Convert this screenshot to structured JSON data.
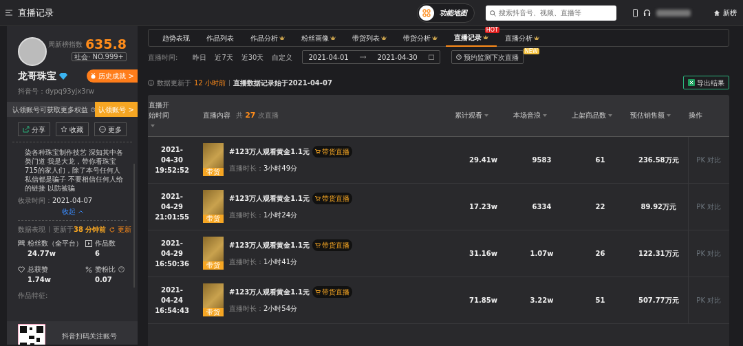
{
  "app_bar": {
    "title": "直播记录",
    "feature_map": "功能地图",
    "search": {
      "placeholder": "搜索抖音号、视频、直播等"
    },
    "new_list": "新榜"
  },
  "profile": {
    "index_label": "周新榜指数",
    "index_value": "635.8",
    "rank": "社会· NO.999+",
    "name": "龙哥珠宝",
    "history_button": "历史成就 >",
    "account_label": "抖音号：",
    "account_id": "dypq93yjx3rw",
    "claim_text": "认领账号可获取更多权益",
    "claim_button": "认领账号 >",
    "actions": [
      {
        "kind": "share",
        "label": "分享"
      },
      {
        "kind": "favorite",
        "label": "收藏"
      },
      {
        "kind": "more",
        "label": "更多"
      }
    ],
    "bio": "染各种珠宝制作技艺 深知其中各类门道 我是大龙，带你看珠宝 715的家人们，除了本号任何人私信都是骗子 不要相信任何人给的链接 以防被骗",
    "collected_label": "收录时间：",
    "collected_date": "2021-04-07",
    "collapse": "收起",
    "data_label": "数据表现",
    "updated_prefix": "更新于",
    "updated_value": "38 分钟前",
    "refresh": "更新",
    "stats": [
      {
        "kind": "fans",
        "label": "粉丝数（全平台）",
        "value": "24.77w"
      },
      {
        "kind": "works",
        "label": "作品数",
        "value": "6"
      },
      {
        "kind": "likes",
        "label": "总获赞",
        "value": "1.74w"
      },
      {
        "kind": "ratio",
        "label": "赞粉比",
        "value": "0.07",
        "help": true
      }
    ],
    "features_label": "作品特征:",
    "qr_text": "抖音扫码关注账号"
  },
  "tabs": [
    {
      "label": "趋势表现",
      "selected": false,
      "premium": false
    },
    {
      "label": "作品列表",
      "selected": false,
      "premium": false
    },
    {
      "label": "作品分析",
      "selected": false,
      "premium": true
    },
    {
      "label": "粉丝画像",
      "selected": false,
      "premium": true
    },
    {
      "label": "带货列表",
      "selected": false,
      "premium": true
    },
    {
      "label": "带货分析",
      "selected": false,
      "premium": true
    },
    {
      "label": "直播记录",
      "selected": true,
      "premium": true,
      "badge": "HOT"
    },
    {
      "label": "直播分析",
      "selected": false,
      "premium": true
    }
  ],
  "filters": {
    "label": "直播时间:",
    "options": [
      "昨日",
      "近7天",
      "近30天",
      "自定义"
    ],
    "date_start": "2021-04-01",
    "date_end": "2021-04-30",
    "monitor_button": "预约监测下次直播",
    "monitor_badge": "NEW"
  },
  "notice": {
    "prefix": "数据更新于",
    "age": "12 小时前",
    "record_start": "直播数据记录始于2021-04-07",
    "export_button": "导出结果"
  },
  "table": {
    "columns": [
      {
        "label": "直播开始时间",
        "sortable": true
      },
      {
        "label": "直播内容",
        "sortable": false,
        "count": "共 **27** 次直播"
      },
      {
        "label": "累计观看",
        "sortable": true
      },
      {
        "label": "本场音浪",
        "sortable": true
      },
      {
        "label": "上架商品数",
        "sortable": true
      },
      {
        "label": "预估销售额",
        "sortable": true
      },
      {
        "label": "操作",
        "sortable": false
      }
    ],
    "rows": [
      {
        "date": "2021-04-30",
        "time": "19:52:52",
        "title": "#123万人观看黄金1.1元",
        "tag": "带货直播",
        "thumb_badge": "带货",
        "duration_label": "直播时长：",
        "duration": "3小时49分",
        "views": "29.41w",
        "gifts": "9583",
        "products": "61",
        "sales": "236.58万元",
        "action": "PK 对比"
      },
      {
        "date": "2021-04-29",
        "time": "21:01:55",
        "title": "#123万人观看黄金1.1元",
        "tag": "带货直播",
        "thumb_badge": "带货",
        "duration_label": "直播时长：",
        "duration": "1小时24分",
        "views": "17.23w",
        "gifts": "6334",
        "products": "22",
        "sales": "89.92万元",
        "action": "PK 对比"
      },
      {
        "date": "2021-04-29",
        "time": "16:50:36",
        "title": "#123万人观看黄金1.1元",
        "tag": "带货直播",
        "thumb_badge": "带货",
        "duration_label": "直播时长：",
        "duration": "1小时41分",
        "views": "31.16w",
        "gifts": "1.07w",
        "products": "26",
        "sales": "122.31万元",
        "action": "PK 对比"
      },
      {
        "date": "2021-04-24",
        "time": "16:54:43",
        "title": "#123万人观看黄金1.1元",
        "tag": "带货直播",
        "thumb_badge": "带货",
        "duration_label": "直播时长：",
        "duration": "2小时54分",
        "views": "71.85w",
        "gifts": "3.22w",
        "products": "51",
        "sales": "507.77万元",
        "action": "PK 对比"
      }
    ]
  }
}
